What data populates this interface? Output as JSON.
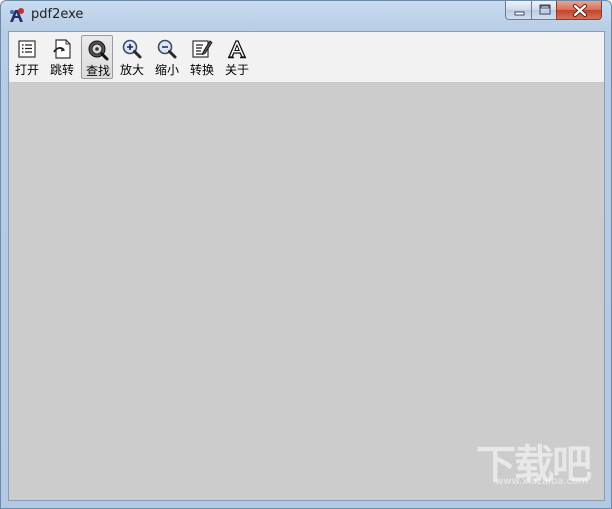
{
  "window": {
    "title": "pdf2exe",
    "icons": {
      "app": "app-logo-icon",
      "minimize": "minimize-icon",
      "maximize": "maximize-icon",
      "close": "close-icon"
    }
  },
  "toolbar": {
    "items": [
      {
        "label": "打开",
        "icon": "open-list-icon",
        "active": false
      },
      {
        "label": "跳转",
        "icon": "goto-page-icon",
        "active": false
      },
      {
        "label": "查找",
        "icon": "find-disc-icon",
        "active": true
      },
      {
        "label": "放大",
        "icon": "zoom-in-icon",
        "active": false
      },
      {
        "label": "缩小",
        "icon": "zoom-out-icon",
        "active": false
      },
      {
        "label": "转换",
        "icon": "convert-edit-icon",
        "active": false
      },
      {
        "label": "关于",
        "icon": "about-font-icon",
        "active": false
      }
    ]
  },
  "watermark": {
    "main": "下载吧",
    "sub": "www.xiazaiba.com"
  },
  "colors": {
    "content_background": "#cccccc",
    "toolbar_background": "#f2f2f2",
    "close_button": "#c4432a"
  }
}
